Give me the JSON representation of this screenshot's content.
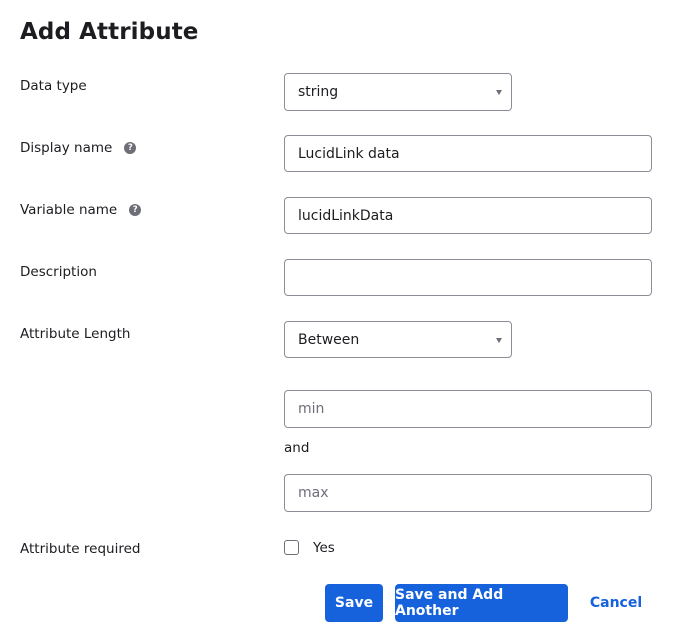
{
  "title": "Add Attribute",
  "fields": {
    "data_type": {
      "label": "Data type",
      "value": "string"
    },
    "display_name": {
      "label": "Display name",
      "value": "LucidLink data",
      "help_icon": "?"
    },
    "variable_name": {
      "label": "Variable name",
      "value": "lucidLinkData",
      "help_icon": "?"
    },
    "description": {
      "label": "Description",
      "value": ""
    },
    "attribute_length": {
      "label": "Attribute Length",
      "value": "Between",
      "min_placeholder": "min",
      "connector": "and",
      "max_placeholder": "max"
    },
    "attribute_required": {
      "label": "Attribute required",
      "checkbox_label": "Yes",
      "checked": false
    }
  },
  "buttons": {
    "save": "Save",
    "save_add_another": "Save and Add Another",
    "cancel": "Cancel"
  },
  "colors": {
    "primary": "#1662dd",
    "text": "#1d1d21",
    "border": "#8c8c96",
    "help_icon": "#6e6e78"
  }
}
